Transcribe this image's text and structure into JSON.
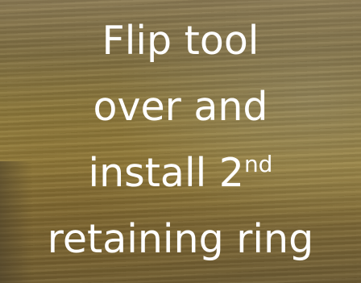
{
  "slide": {
    "caption_lines": [
      "Flip tool",
      "over and",
      "install 2",
      "retaining ring"
    ],
    "ordinal_suffix": "nd"
  }
}
